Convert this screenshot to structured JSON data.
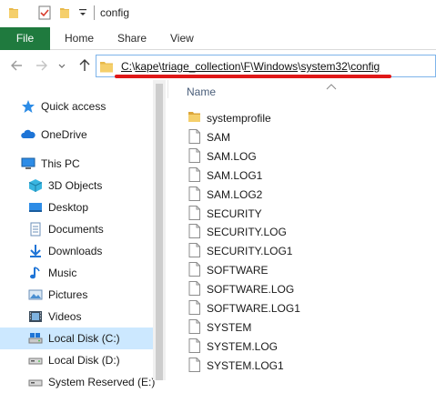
{
  "window": {
    "title": "config"
  },
  "ribbon": {
    "tabs": {
      "file": "File",
      "home": "Home",
      "share": "Share",
      "view": "View"
    }
  },
  "address": {
    "segments": [
      "C:",
      "kape",
      "triage_collection",
      "F",
      "Windows",
      "system32",
      "config"
    ],
    "separator": "\\"
  },
  "nav": {
    "quick_access": "Quick access",
    "onedrive": "OneDrive",
    "this_pc": "This PC",
    "objects_3d": "3D Objects",
    "desktop": "Desktop",
    "documents": "Documents",
    "downloads": "Downloads",
    "music": "Music",
    "pictures": "Pictures",
    "videos": "Videos",
    "local_disk_c": "Local Disk (C:)",
    "local_disk_d": "Local Disk (D:)",
    "system_reserved": "System Reserved (E:)"
  },
  "content": {
    "column_header": "Name",
    "files": [
      {
        "name": "systemprofile",
        "type": "folder"
      },
      {
        "name": "SAM",
        "type": "file"
      },
      {
        "name": "SAM.LOG",
        "type": "file"
      },
      {
        "name": "SAM.LOG1",
        "type": "file"
      },
      {
        "name": "SAM.LOG2",
        "type": "file"
      },
      {
        "name": "SECURITY",
        "type": "file"
      },
      {
        "name": "SECURITY.LOG",
        "type": "file"
      },
      {
        "name": "SECURITY.LOG1",
        "type": "file"
      },
      {
        "name": "SOFTWARE",
        "type": "file"
      },
      {
        "name": "SOFTWARE.LOG",
        "type": "file"
      },
      {
        "name": "SOFTWARE.LOG1",
        "type": "file"
      },
      {
        "name": "SYSTEM",
        "type": "file"
      },
      {
        "name": "SYSTEM.LOG",
        "type": "file"
      },
      {
        "name": "SYSTEM.LOG1",
        "type": "file"
      }
    ]
  },
  "colors": {
    "file_tab": "#1f7a3e",
    "selection": "#cce8ff",
    "annotation_underline": "#e01818",
    "folder": "#e8b94a"
  }
}
